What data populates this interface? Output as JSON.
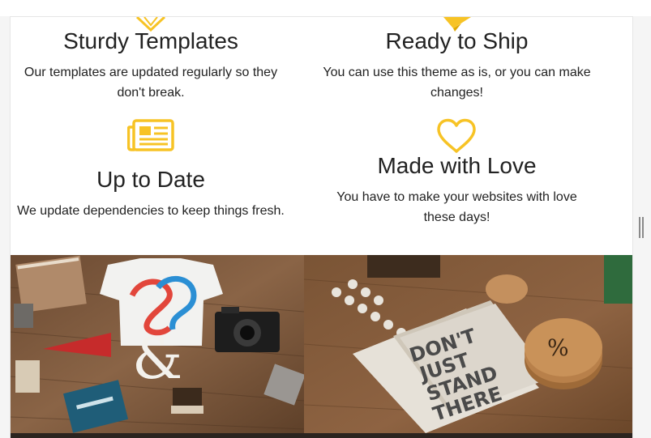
{
  "features": [
    {
      "title": "Sturdy Templates",
      "desc_line1": "Our templates are updated regularly so they",
      "desc_line2": "don't break.",
      "icon": "diamond-icon"
    },
    {
      "title": "Ready to Ship",
      "desc_line1": "You can use this theme as is, or you can make",
      "desc_line2": "changes!",
      "icon": "paper-plane-icon"
    },
    {
      "title": "Up to Date",
      "desc_line1": "We update dependencies to keep things fresh.",
      "desc_line2": "",
      "icon": "newspaper-icon"
    },
    {
      "title": "Made with Love",
      "desc_line1": "You have to make your websites with love",
      "desc_line2": "these days!",
      "icon": "heart-icon"
    }
  ],
  "portfolio": [
    {
      "name": "back-to-school-flatlay"
    },
    {
      "name": "dont-just-stand-there-notebook"
    }
  ],
  "colors": {
    "accent": "#f7c325",
    "text": "#222222",
    "background": "#ffffff"
  }
}
